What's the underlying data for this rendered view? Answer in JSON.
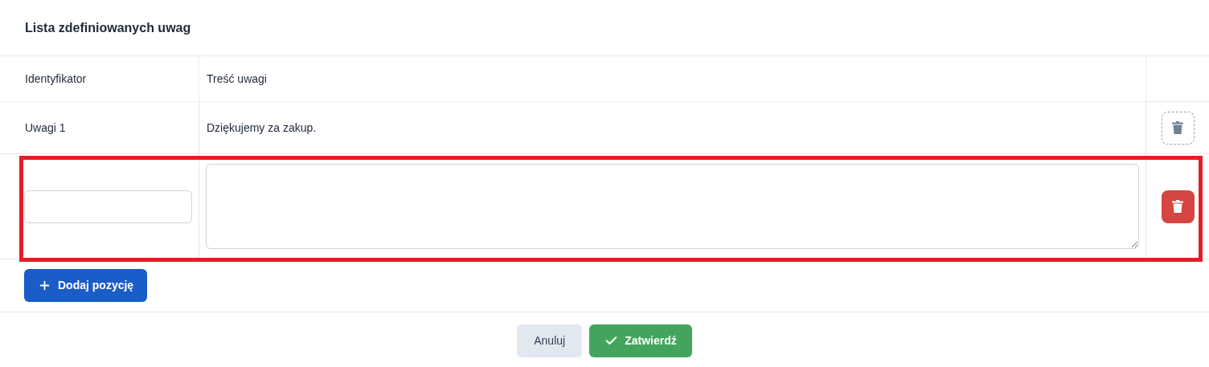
{
  "title": "Lista zdefiniowanych uwag",
  "table": {
    "columns": [
      "Identyfikator",
      "Treść uwagi"
    ],
    "rows": [
      {
        "kind": "text",
        "identifier": "Uwagi 1",
        "content": "Dziękujemy za zakup.",
        "delete_disabled": true,
        "highlighted": false
      },
      {
        "kind": "edit",
        "identifier": "",
        "content": "",
        "delete_disabled": false,
        "highlighted": true
      }
    ]
  },
  "add_button": "Dodaj pozycję",
  "footer": {
    "cancel": "Anuluj",
    "confirm": "Zatwierdź"
  }
}
